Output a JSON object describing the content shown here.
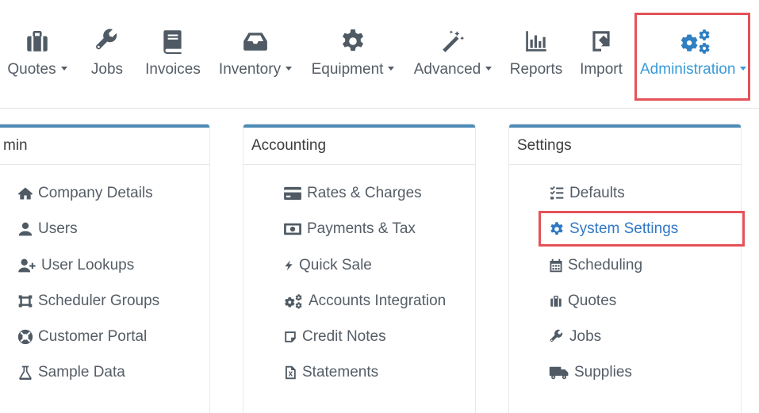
{
  "nav": {
    "items": [
      {
        "label": "Quotes",
        "icon": "briefcase-icon",
        "dropdown": true
      },
      {
        "label": "Jobs",
        "icon": "wrench-icon",
        "dropdown": false
      },
      {
        "label": "Invoices",
        "icon": "book-icon",
        "dropdown": false
      },
      {
        "label": "Inventory",
        "icon": "inbox-icon",
        "dropdown": true
      },
      {
        "label": "Equipment",
        "icon": "gear-icon",
        "dropdown": true
      },
      {
        "label": "Advanced",
        "icon": "magic-wand-icon",
        "dropdown": true
      },
      {
        "label": "Reports",
        "icon": "bar-chart-icon",
        "dropdown": false
      },
      {
        "label": "Import",
        "icon": "import-icon",
        "dropdown": false
      },
      {
        "label": "Administration",
        "icon": "cogs-icon",
        "dropdown": true,
        "active": true
      }
    ]
  },
  "panels": {
    "admin": {
      "title": "min",
      "items": [
        "Company Details",
        "Users",
        "User Lookups",
        "Scheduler Groups",
        "Customer Portal",
        "Sample Data"
      ]
    },
    "accounting": {
      "title": "Accounting",
      "items": [
        "Rates & Charges",
        "Payments & Tax",
        "Quick Sale",
        "Accounts Integration",
        "Credit Notes",
        "Statements"
      ]
    },
    "settings": {
      "title": "Settings",
      "items": [
        "Defaults",
        "System Settings",
        "Scheduling",
        "Quotes",
        "Jobs",
        "Supplies"
      ]
    }
  },
  "colors": {
    "accent": "#3a9ad9",
    "panel_border": "#4c8bb5",
    "highlight": "#e45258"
  }
}
